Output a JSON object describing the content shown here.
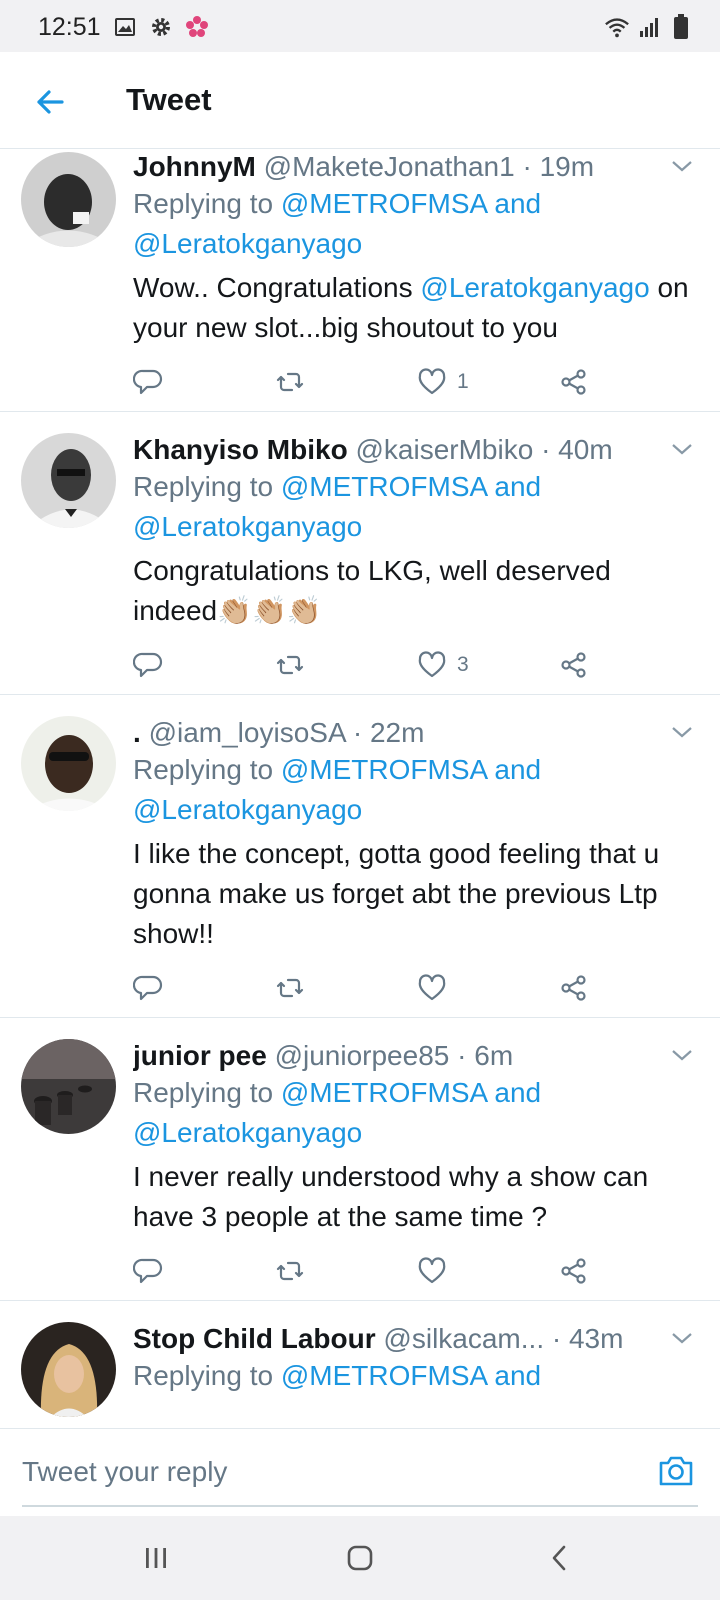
{
  "status_bar": {
    "time": "12:51",
    "left_icons": [
      "image-icon",
      "gear-icon",
      "flower-icon"
    ],
    "right_icons": [
      "wifi-icon",
      "signal-icon",
      "battery-icon"
    ]
  },
  "header": {
    "title": "Tweet",
    "back_icon": "arrow-left-icon"
  },
  "colors": {
    "accent": "#1b95e0",
    "text": "#14171a",
    "muted": "#657786",
    "divider": "#e1e8ed",
    "system_bar": "#f1f1f3"
  },
  "tweets": [
    {
      "name": "JohnnyM",
      "handle": "@MaketeJonathan1",
      "time": "· 19m",
      "reply_prefix": "Replying to ",
      "reply_users": "@METROFMSA and",
      "reply_users_2": "@Leratokganyago",
      "text_before": "Wow.. Congratulations ",
      "text_mention": "@Leratokganyago",
      "text_after": " on your new slot...big shoutout to you",
      "likes": "1"
    },
    {
      "name": "Khanyiso Mbiko",
      "handle": "@kaiserMbiko",
      "time": "· 40m",
      "reply_prefix": "Replying to ",
      "reply_users": "@METROFMSA and",
      "reply_users_2": "@Leratokganyago",
      "text": "Congratulations to LKG, well deserved indeed👏🏼👏🏼👏🏼",
      "likes": "3"
    },
    {
      "name": ".",
      "handle": "@iam_loyisoSA",
      "time": "· 22m",
      "reply_prefix": "Replying to ",
      "reply_users": "@METROFMSA and",
      "reply_users_2": "@Leratokganyago",
      "text": "I like the concept, gotta good feeling that u gonna make us forget abt the previous Ltp show!!",
      "likes": ""
    },
    {
      "name": "junior pee",
      "handle": "@juniorpee85",
      "time": "· 6m",
      "reply_prefix": "Replying to ",
      "reply_users": "@METROFMSA and",
      "reply_users_2": "@Leratokganyago",
      "text": "I never really understood why a show can have 3 people at the same time ?",
      "likes": ""
    },
    {
      "name": "Stop Child Labour",
      "handle": "@silkacam...",
      "time": "· 43m",
      "reply_prefix": "Replying to ",
      "reply_users": "@METROFMSA and"
    }
  ],
  "reply_bar": {
    "placeholder": "Tweet your reply",
    "camera_icon": "camera-icon"
  },
  "nav_bar": {
    "buttons": [
      "recents-icon",
      "home-icon",
      "back-icon"
    ]
  }
}
